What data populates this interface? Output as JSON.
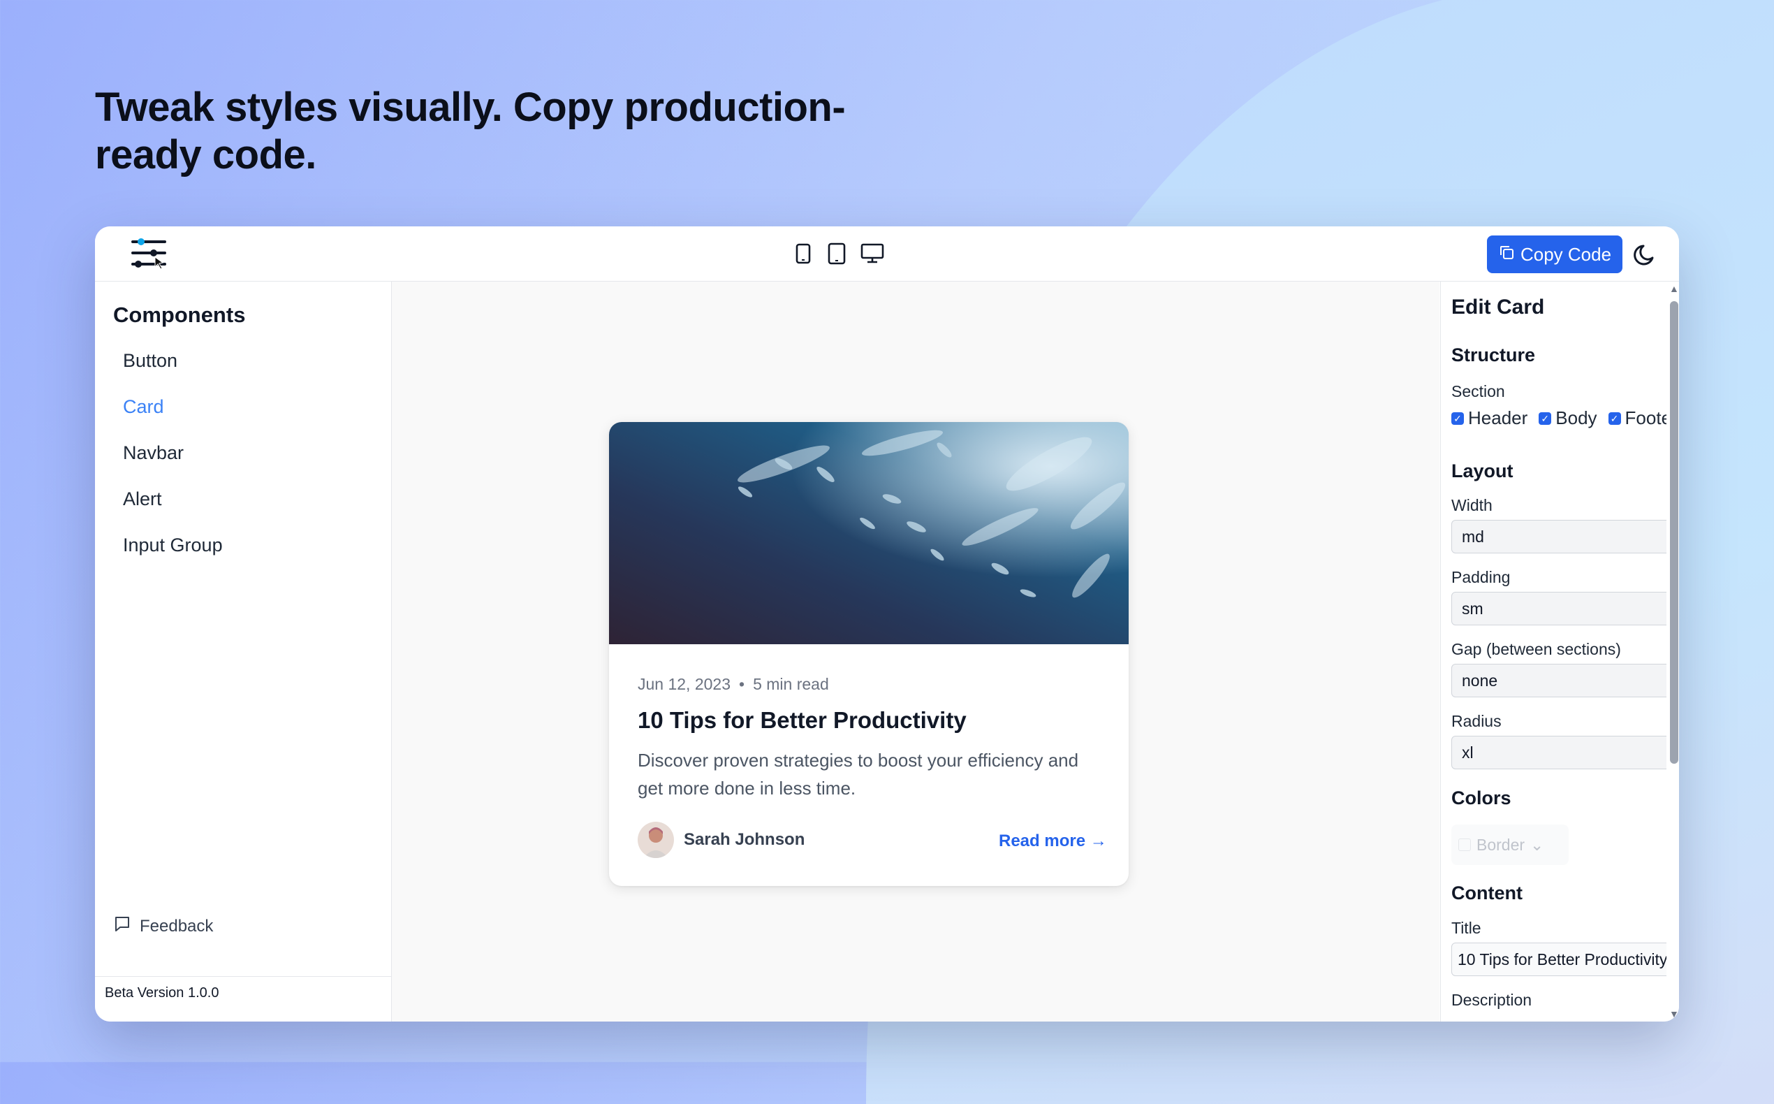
{
  "hero": {
    "title": "Tweak styles visually. Copy production-ready code."
  },
  "topbar": {
    "devices": [
      "mobile-icon",
      "tablet-icon",
      "desktop-icon"
    ],
    "copy_label": "Copy Code"
  },
  "sidebar": {
    "heading": "Components",
    "items": [
      {
        "label": "Button",
        "active": false
      },
      {
        "label": "Card",
        "active": true
      },
      {
        "label": "Navbar",
        "active": false
      },
      {
        "label": "Alert",
        "active": false
      },
      {
        "label": "Input Group",
        "active": false
      }
    ],
    "feedback": "Feedback",
    "version": "Beta Version 1.0.0"
  },
  "card": {
    "date": "Jun 12, 2023",
    "separator": "•",
    "read_time": "5 min read",
    "title": "10 Tips for Better Productivity",
    "description": "Discover proven strategies to boost your efficiency and get more done in less time.",
    "author": "Sarah Johnson",
    "read_more": "Read more →"
  },
  "panel": {
    "title": "Edit Card",
    "structure": {
      "heading": "Structure",
      "section_label": "Section",
      "checks": [
        {
          "label": "Header",
          "checked": true
        },
        {
          "label": "Body",
          "checked": true
        },
        {
          "label": "Footer",
          "checked": true
        }
      ]
    },
    "layout": {
      "heading": "Layout",
      "width_label": "Width",
      "width_value": "md",
      "padding_label": "Padding",
      "padding_value": "sm",
      "gap_label": "Gap (between sections)",
      "gap_value": "none",
      "radius_label": "Radius",
      "radius_value": "xl"
    },
    "colors": {
      "heading": "Colors",
      "border_label": "Border"
    },
    "content": {
      "heading": "Content",
      "title_label": "Title",
      "title_value": "10 Tips for Better Productivity",
      "description_label": "Description"
    }
  },
  "colors": {
    "accent": "#2563eb",
    "active_nav": "#3b82f6"
  }
}
